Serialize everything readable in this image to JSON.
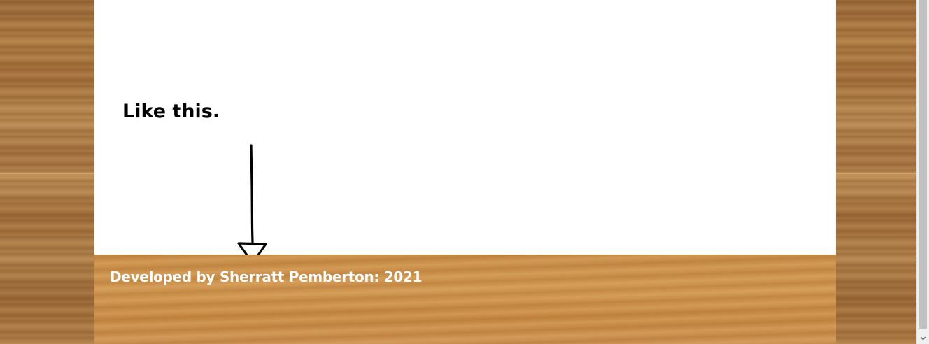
{
  "content": {
    "note_text": "Like this."
  },
  "footer": {
    "text": "Developed by Sherratt Pemberton: 2021"
  },
  "icons": {
    "annotation_arrow": "hand-drawn-down-arrow-icon",
    "scroll_down": "chevron-down-icon"
  },
  "colors": {
    "footer_bg": "#cc9150",
    "footer_text": "#ffffff",
    "content_bg": "#ffffff",
    "wood": "#a87440"
  }
}
